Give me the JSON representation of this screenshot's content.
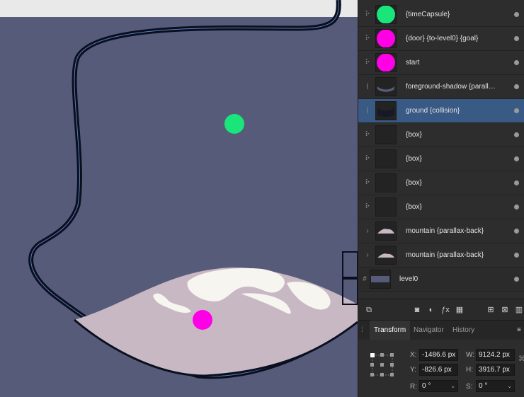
{
  "layers": [
    {
      "label": "{timeCapsule}",
      "icon": "move-icon",
      "thumb": "green-circle",
      "selected": false
    },
    {
      "label": "{door} {to-level0} {goal}",
      "icon": "move-icon",
      "thumb": "magenta-circle",
      "selected": false
    },
    {
      "label": "start",
      "icon": "move-icon",
      "thumb": "magenta-circle",
      "selected": false
    },
    {
      "label": "foreground-shadow {parall…",
      "icon": "curve-icon",
      "thumb": "dark-shape",
      "selected": false
    },
    {
      "label": "ground {collision}",
      "icon": "curve-icon",
      "thumb": "dark-shape",
      "selected": true
    },
    {
      "label": "{box}",
      "icon": "move-icon",
      "thumb": "empty",
      "selected": false
    },
    {
      "label": "{box}",
      "icon": "move-icon",
      "thumb": "empty",
      "selected": false
    },
    {
      "label": "{box}",
      "icon": "move-icon",
      "thumb": "empty",
      "selected": false
    },
    {
      "label": "{box}",
      "icon": "move-icon",
      "thumb": "empty",
      "selected": false
    },
    {
      "label": "mountain {parallax-back}",
      "icon": "chevron-right-icon",
      "thumb": "mountain",
      "selected": false
    },
    {
      "label": "mountain {parallax-back}",
      "icon": "chevron-right-icon",
      "thumb": "mountain",
      "selected": false
    },
    {
      "label": "level0",
      "icon": "artboard-icon",
      "thumb": "level",
      "selected": false
    }
  ],
  "tabs": {
    "transform": "Transform",
    "navigator": "Navigator",
    "history": "History"
  },
  "transform": {
    "x_label": "X:",
    "x_value": "-1486.6 px",
    "y_label": "Y:",
    "y_value": "-826.6 px",
    "w_label": "W:",
    "w_value": "9124.2 px",
    "h_label": "H:",
    "h_value": "3916.7 px",
    "r_label": "R:",
    "r_value": "0 °",
    "s_label": "S:",
    "s_value": "0 °"
  },
  "colors": {
    "canvas": "#575b7a",
    "green_object": "#19e57a",
    "magenta_object": "#ff00e6",
    "ground": "#c8b8c4",
    "snow": "#f7f5ef",
    "selection": "#3a5a86"
  }
}
